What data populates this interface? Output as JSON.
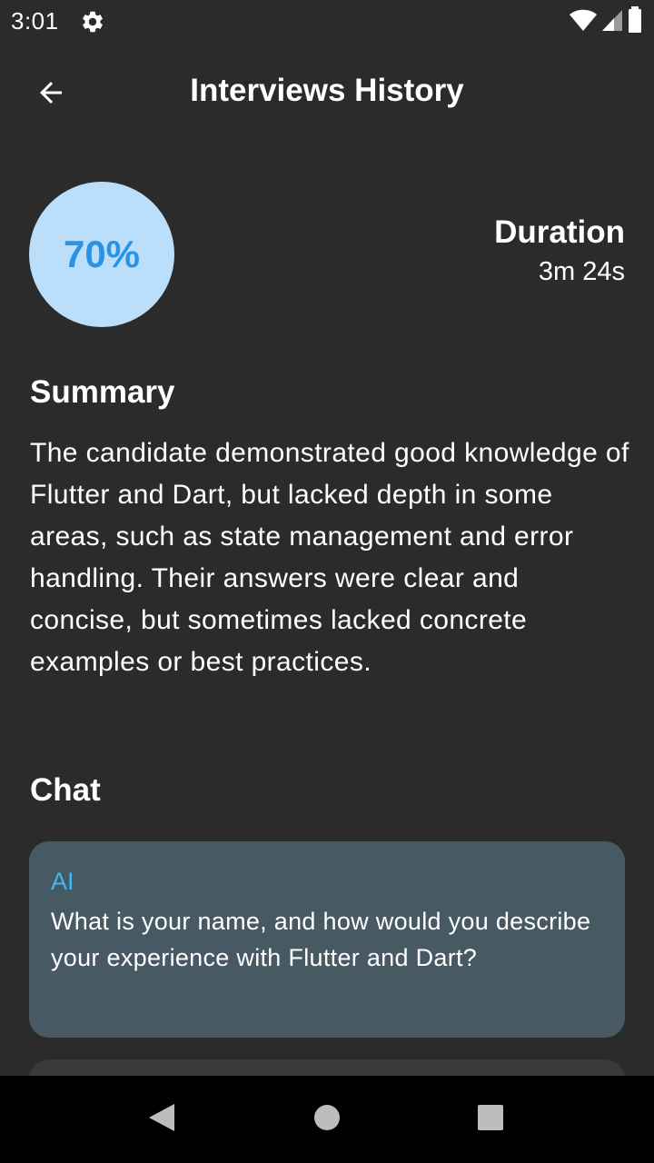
{
  "status_bar": {
    "time": "3:01",
    "icons": [
      "settings-icon",
      "wifi-icon",
      "signal-icon",
      "battery-icon"
    ]
  },
  "app_bar": {
    "title": "Interviews History",
    "back_icon": "arrow-back-icon"
  },
  "score": {
    "value": "70%",
    "percent": 70,
    "circle_color": "#bbdefb",
    "text_color": "#2a93e6"
  },
  "duration": {
    "label": "Duration",
    "value": "3m 24s"
  },
  "summary": {
    "heading": "Summary",
    "text": "The candidate demonstrated good knowledge of Flutter and Dart, but lacked depth in some areas, such as state management and error handling. Their answers were clear and concise, but sometimes lacked concrete examples or best practices."
  },
  "chat": {
    "heading": "Chat",
    "messages": [
      {
        "sender": "AI",
        "text": "What is your name, and how would you describe your experience with Flutter and Dart?"
      }
    ],
    "bubble_color": "#475963",
    "sender_color": "#42b5f5"
  },
  "nav_bar": {
    "icons": [
      "back-triangle-icon",
      "home-circle-icon",
      "recents-square-icon"
    ]
  }
}
